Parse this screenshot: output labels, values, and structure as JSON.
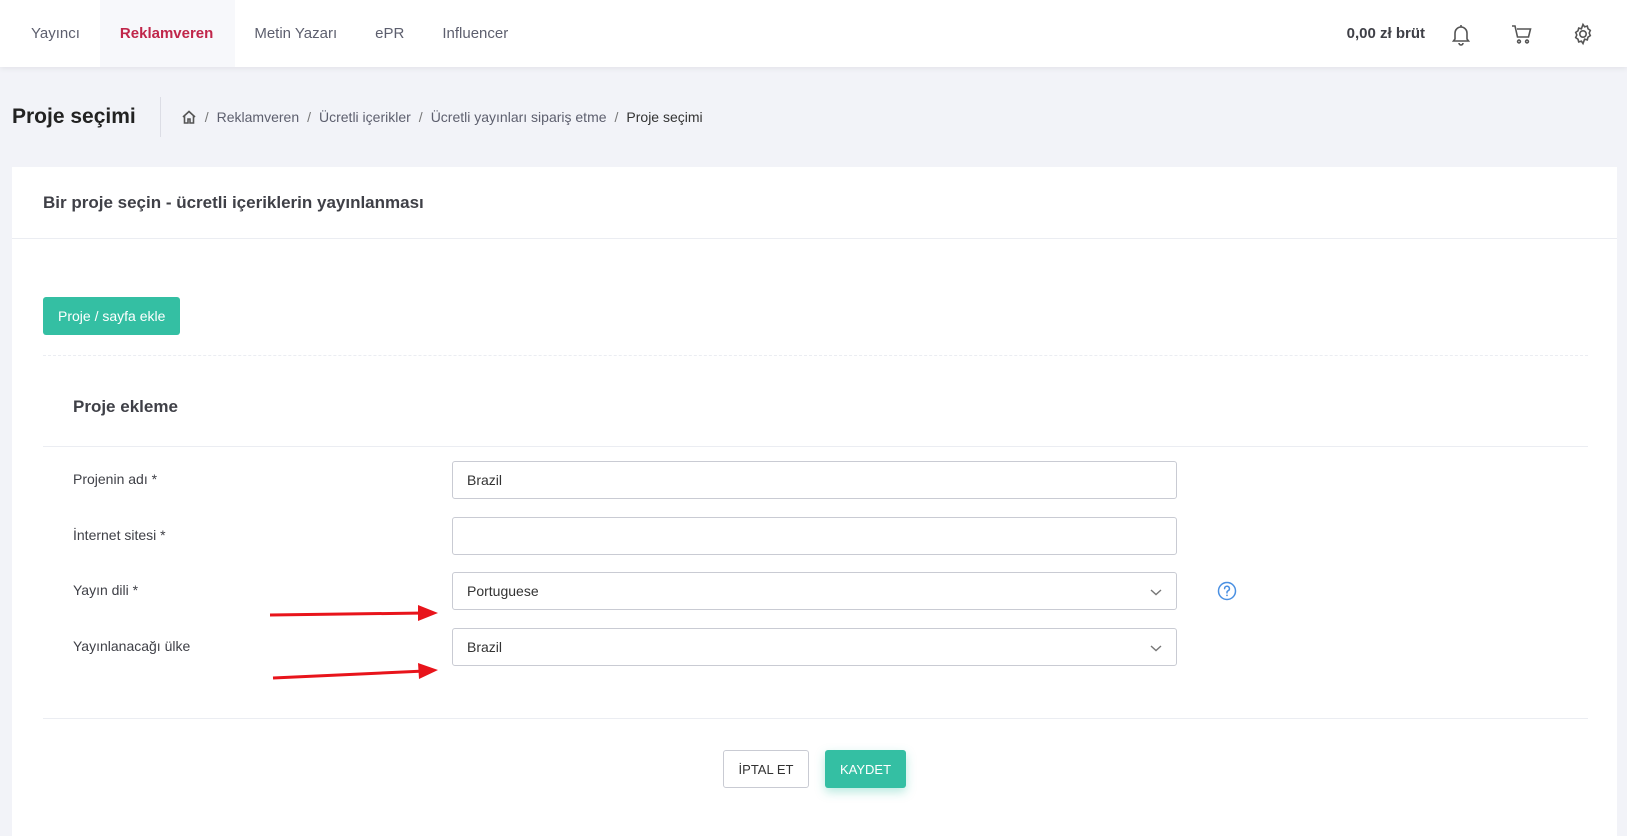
{
  "nav": {
    "tabs": [
      {
        "label": "Yayıncı",
        "active": false
      },
      {
        "label": "Reklamveren",
        "active": true
      },
      {
        "label": "Metin Yazarı",
        "active": false
      },
      {
        "label": "ePR",
        "active": false
      },
      {
        "label": "Influencer",
        "active": false
      }
    ],
    "balance": "0,00 zł brüt",
    "icons": [
      "bell-icon",
      "cart-icon",
      "gear-icon"
    ]
  },
  "subheader": {
    "title": "Proje seçimi",
    "breadcrumb": [
      "Reklamveren",
      "Ücretli içerikler",
      "Ücretli yayınları sipariş etme",
      "Proje seçimi"
    ]
  },
  "card": {
    "title": "Bir proje seçin - ücretli içeriklerin yayınlanması",
    "add_button": "Proje / sayfa ekle",
    "section_title": "Proje ekleme",
    "fields": {
      "project_name": {
        "label": "Projenin adı *",
        "value": "Brazil"
      },
      "website": {
        "label": "İnternet sitesi *",
        "value": ""
      },
      "language": {
        "label": "Yayın dili *",
        "value": "Portuguese"
      },
      "country": {
        "label": "Yayınlanacağı ülke",
        "value": "Brazil"
      }
    },
    "cancel_button": "İPTAL ET",
    "save_button": "KAYDET"
  },
  "colors": {
    "accent": "#34bfa3",
    "active_tab": "#c0264a",
    "annotation_arrow": "#e8141b",
    "help_icon": "#4a90e2"
  }
}
